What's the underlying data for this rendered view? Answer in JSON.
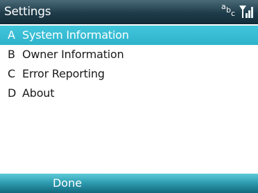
{
  "header": {
    "title": "Settings",
    "input_mode": {
      "a": "a",
      "b": "b",
      "c": "c"
    },
    "icons": {
      "signal": "signal-strength-icon"
    }
  },
  "menu": {
    "selected_index": 0,
    "items": [
      {
        "key": "A",
        "label": "System Information"
      },
      {
        "key": "B",
        "label": "Owner Information"
      },
      {
        "key": "C",
        "label": "Error Reporting"
      },
      {
        "key": "D",
        "label": "About"
      }
    ]
  },
  "softkeys": {
    "left": "Done"
  },
  "colors": {
    "titlebar": "#1f3c4a",
    "selection": "#38bcd2",
    "softkeybar": "#2f9eb2",
    "text": "#1a1a1a"
  }
}
